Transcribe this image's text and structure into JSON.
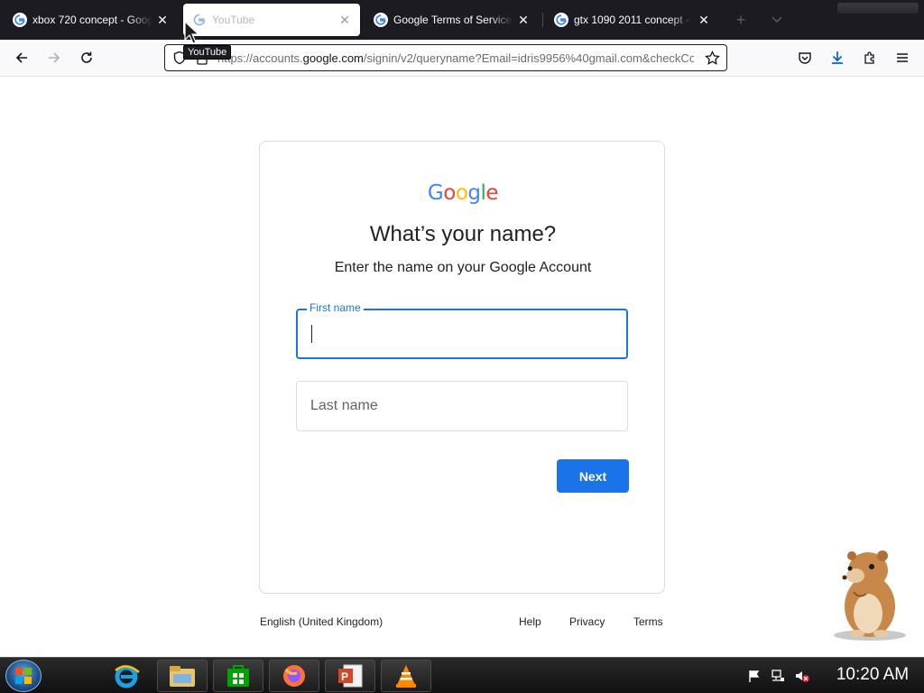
{
  "browser": {
    "tabs": [
      {
        "title": "xbox 720 concept - Google Se",
        "favicon": "google-g-icon",
        "active": false
      },
      {
        "title": "YouTube",
        "favicon": "google-g-icon",
        "active": true
      },
      {
        "title": "Google Terms of Service – Priv",
        "favicon": "google-g-icon",
        "active": false
      },
      {
        "title": "gtx 1090 2011 concept - Goog",
        "favicon": "google-g-icon",
        "active": false
      }
    ],
    "tooltip": "YouTube",
    "url": {
      "prefix": "https://accounts.",
      "domain": "google.com",
      "suffix": "/signin/v2/queryname?Email=idris9956%40gmail.com&checkCo"
    }
  },
  "page": {
    "logo_letters": [
      {
        "char": "G",
        "color": "#4285F4"
      },
      {
        "char": "o",
        "color": "#EA4335"
      },
      {
        "char": "o",
        "color": "#FBBC05"
      },
      {
        "char": "g",
        "color": "#4285F4"
      },
      {
        "char": "l",
        "color": "#34A853"
      },
      {
        "char": "e",
        "color": "#EA4335"
      }
    ],
    "heading": "What’s your name?",
    "subheading": "Enter the name on your Google Account",
    "first_name": {
      "label": "First name",
      "value": ""
    },
    "last_name": {
      "placeholder": "Last name",
      "value": ""
    },
    "next_label": "Next"
  },
  "footer": {
    "language": "English (United Kingdom)",
    "links": [
      "Help",
      "Privacy",
      "Terms"
    ]
  },
  "taskbar": {
    "apps": [
      "internet-explorer-icon",
      "file-explorer-icon",
      "store-icon",
      "firefox-icon",
      "powerpoint-icon",
      "vlc-icon"
    ],
    "clock": "10:20 AM"
  },
  "colors": {
    "google_blue": "#1a73e8",
    "text": "#202124",
    "border": "#dadce0"
  }
}
